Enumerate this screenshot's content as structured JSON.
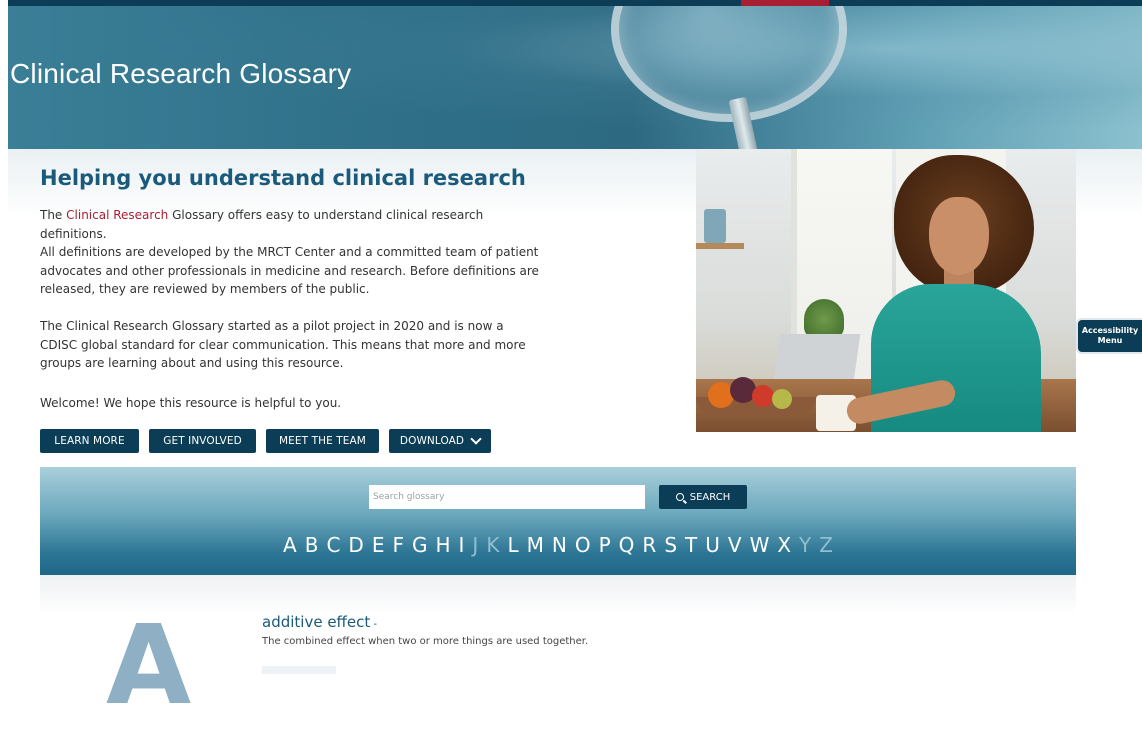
{
  "hero": {
    "title": "Clinical Research Glossary"
  },
  "intro": {
    "headline": "Helping you understand clinical research",
    "p1_before": "The ",
    "p1_link": "Clinical Research",
    "p1_after": " Glossary offers easy to understand clinical research definitions.",
    "p2": "All definitions are developed by the MRCT Center and a committed team of patient advocates and other professionals in medicine and research.  Before definitions are released, they are reviewed by members of the public.",
    "p3": "The Clinical Research Glossary started as a pilot project in 2020 and is now a CDISC global standard for clear communication. This means that more and more groups are learning about and using this resource.",
    "p4": "Welcome! We hope this resource is helpful to you."
  },
  "buttons": {
    "learn_more": "LEARN MORE",
    "get_involved": "GET INVOLVED",
    "meet_the_team": "MEET THE TEAM",
    "download": "DOWNLOAD"
  },
  "search": {
    "placeholder": "Search glossary",
    "button_label": "SEARCH",
    "letters": [
      "A",
      "B",
      "C",
      "D",
      "E",
      "F",
      "G",
      "H",
      "I",
      "J",
      "K",
      "L",
      "M",
      "N",
      "O",
      "P",
      "Q",
      "R",
      "S",
      "T",
      "U",
      "V",
      "W",
      "X",
      "Y",
      "Z"
    ],
    "disabled_letters": [
      "J",
      "K",
      "Y",
      "Z"
    ]
  },
  "entries": {
    "section_letter": "A",
    "term": "additive effect",
    "term_suffix": " -",
    "definition": "The combined effect when two or more things are used together."
  },
  "accessibility": {
    "line1": "Accessibility",
    "line2": "Menu"
  },
  "colors": {
    "navy": "#0c3d56",
    "accent_red": "#a81e32",
    "heading_blue": "#1a5a7a"
  }
}
